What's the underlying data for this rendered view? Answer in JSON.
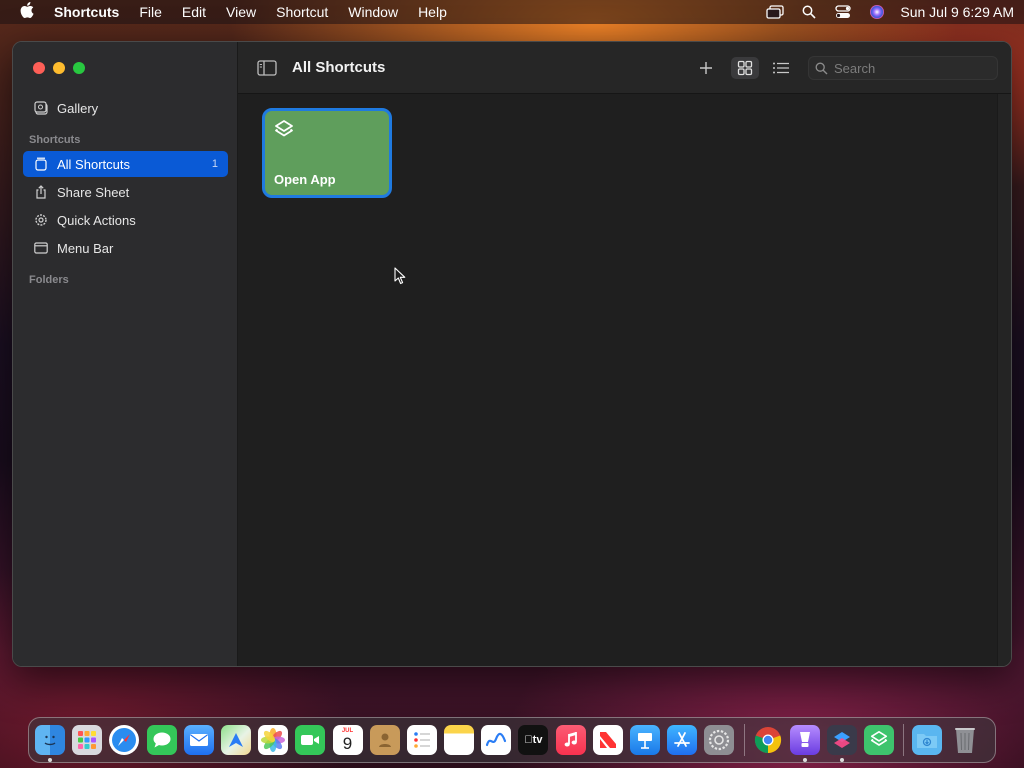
{
  "menubar": {
    "app_name": "Shortcuts",
    "menus": [
      "File",
      "Edit",
      "View",
      "Shortcut",
      "Window",
      "Help"
    ],
    "clock": "Sun Jul 9  6:29 AM",
    "status_icons": [
      "screen-mirroring-icon",
      "spotlight-search-icon",
      "control-center-icon",
      "siri-icon"
    ]
  },
  "sidebar": {
    "gallery_label": "Gallery",
    "section_shortcuts": "Shortcuts",
    "items": [
      {
        "label": "All Shortcuts",
        "count": "1",
        "icon": "stack-icon",
        "active": true
      },
      {
        "label": "Share Sheet",
        "count": "",
        "icon": "share-icon",
        "active": false
      },
      {
        "label": "Quick Actions",
        "count": "",
        "icon": "gear-icon",
        "active": false
      },
      {
        "label": "Menu Bar",
        "count": "",
        "icon": "menubar-icon",
        "active": false
      }
    ],
    "section_folders": "Folders"
  },
  "toolbar": {
    "title": "All Shortcuts",
    "search_placeholder": "Search"
  },
  "shortcuts": [
    {
      "label": "Open App",
      "color": "#5f9e5c",
      "icon": "shortcuts-layers-icon",
      "selected": true
    }
  ],
  "colors": {
    "accent": "#0a5ad6",
    "card_green": "#5f9e5c",
    "selection_border": "#1f7ae0"
  },
  "dock": {
    "apps": [
      "Finder",
      "Launchpad",
      "Safari",
      "Messages",
      "Mail",
      "Maps",
      "Photos",
      "FaceTime",
      "Calendar",
      "Contacts",
      "Reminders",
      "Notes",
      "Freeform",
      "TV",
      "Music",
      "News",
      "Keynote",
      "App Store",
      "System Settings",
      "Chrome",
      "Marker",
      "Shortcuts App",
      "Shortcuts",
      "Downloads",
      "Trash"
    ],
    "calendar_month": "JUL",
    "calendar_day": "9",
    "tv_label": "tv"
  }
}
